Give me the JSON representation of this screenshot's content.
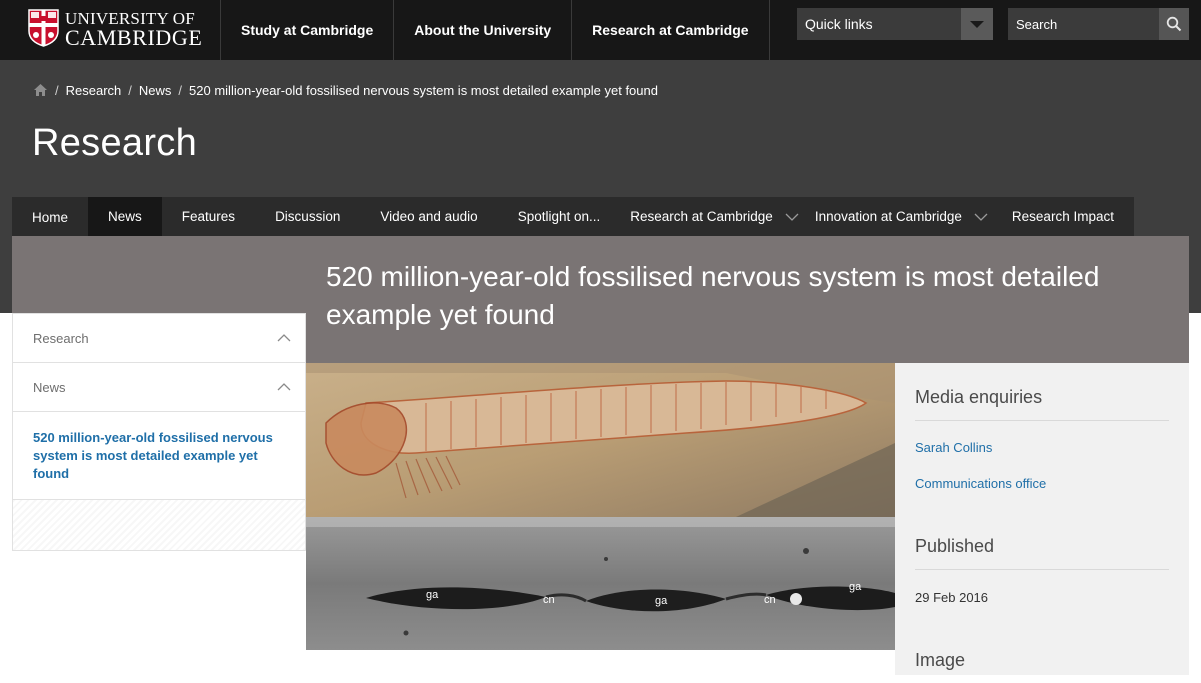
{
  "header": {
    "logo_line1": "UNIVERSITY OF",
    "logo_line2": "CAMBRIDGE",
    "nav": [
      "Study at Cambridge",
      "About the University",
      "Research at Cambridge"
    ],
    "quick_links_label": "Quick links",
    "search_placeholder": "Search"
  },
  "breadcrumb": {
    "items": [
      "Research",
      "News",
      "520 million-year-old fossilised nervous system is most detailed example yet found"
    ]
  },
  "section_title": "Research",
  "section_nav": {
    "items": [
      {
        "label": "Home"
      },
      {
        "label": "News"
      },
      {
        "label": "Features"
      },
      {
        "label": "Discussion"
      },
      {
        "label": "Video and audio"
      },
      {
        "label": "Spotlight on..."
      },
      {
        "label": "Research at Cambridge"
      },
      {
        "label": "Innovation at Cambridge"
      },
      {
        "label": "Research Impact"
      }
    ],
    "active": "News"
  },
  "article": {
    "title": "520 million-year-old fossilised nervous system is most detailed example yet found"
  },
  "sidebar": {
    "items": [
      {
        "label": "Research"
      },
      {
        "label": "News"
      }
    ],
    "current": "520 million-year-old fossilised nervous system is most detailed example yet found"
  },
  "image": {
    "labels": [
      "ga",
      "cn",
      "ga",
      "cn",
      "ga"
    ]
  },
  "info": {
    "media_heading": "Media enquiries",
    "contact_name": "Sarah Collins",
    "contact_org": "Communications office",
    "published_heading": "Published",
    "published_date": "29 Feb 2016",
    "image_heading": "Image"
  },
  "colors": {
    "header_bg": "#171717",
    "section_bg": "#3e3e3e",
    "band_bg": "#7a7474",
    "link": "#1f6fa8"
  }
}
